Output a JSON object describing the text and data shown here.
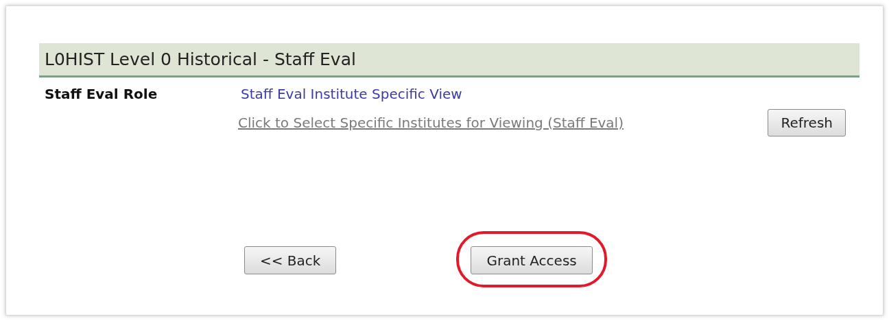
{
  "section": {
    "title": "L0HIST Level 0 Historical - Staff Eval"
  },
  "role": {
    "label": "Staff Eval Role",
    "value": "Staff Eval Institute Specific View",
    "link": "Click to Select Specific Institutes for Viewing (Staff Eval)",
    "refresh_button": "Refresh"
  },
  "buttons": [
    {
      "label": "<< Back",
      "highlighted": false
    },
    {
      "label": "Grant Access",
      "highlighted": true
    }
  ]
}
